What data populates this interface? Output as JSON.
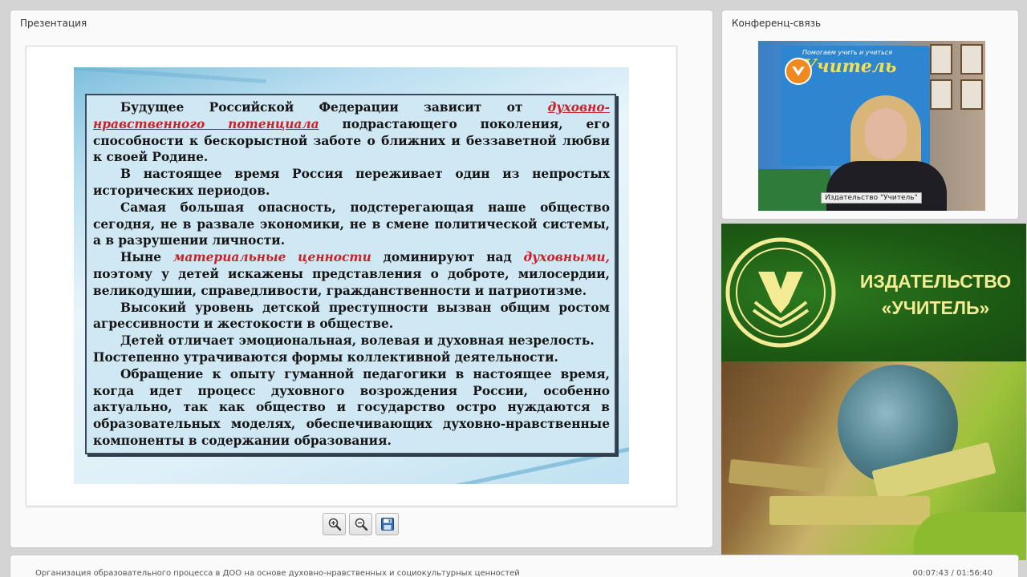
{
  "presentation": {
    "title": "Презентация",
    "slide": {
      "p1_a": "Будущее Российской Федерации зависит от ",
      "p1_hl": "духовно-нравственного потенциала",
      "p1_b": " подрастающего поколения, его способности к бескорыстной заботе о ближних и беззаветной любви к своей Родине.",
      "p2": "В настоящее время Россия переживает один из непростых исторических периодов.",
      "p3": "Самая большая опасность, подстерегающая наше общество сегодня, не в развале экономики, не в смене политической системы, а в разрушении личности.",
      "p4_a": "Ныне ",
      "p4_hl1": "материальные ценности",
      "p4_b": " доминируют над ",
      "p4_hl2": "духовными,",
      "p4_c": " поэтому у детей искажены представления о доброте, милосердии, великодушии, справедливости, гражданственности и патриотизме.",
      "p5": "Высокий уровень детской преступности вызван общим ростом агрессивности и жестокости в обществе.",
      "p6": "Детей отличает эмоциональная, волевая и духовная незрелость.",
      "p7": "Постепенно утрачиваются формы коллективной деятельности.",
      "p8": "Обращение к опыту гуманной педагогики в настоящее время, когда идет процесс духовного возрождения России, особенно актуально, так как общество и государство остро нуждаются в образовательных моделях, обеспечивающих духовно-нравственные компоненты в содержании образования."
    },
    "toolbar": {
      "zoom_in_icon": "zoom-in-icon",
      "zoom_out_icon": "zoom-out-icon",
      "save_icon": "save-icon"
    }
  },
  "conference": {
    "title": "Конференц-связь",
    "banner_slogan": "Помогаем учить и учиться",
    "banner_brand": "Учитель",
    "video_caption": "Издательство \"Учитель\""
  },
  "publisher": {
    "line1": "ИЗДАТЕЛЬСТВО",
    "line2": "«УЧИТЕЛЬ»"
  },
  "footer": {
    "course_title": "Организация образовательного процесса в ДОО на основе духовно-нравственных и социокультурных ценностей",
    "time": "00:07:43 / 01:56:40"
  },
  "colors": {
    "highlight": "#c8222a",
    "publisher_green": "#1d5a14",
    "publisher_text": "#f4ec95"
  }
}
